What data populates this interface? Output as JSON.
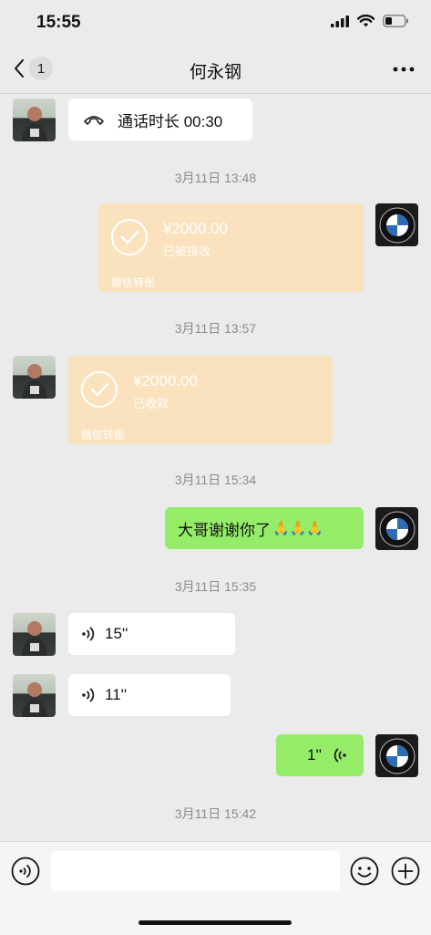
{
  "status_bar": {
    "time": "15:55"
  },
  "nav": {
    "back_count": "1",
    "title": "何永钢"
  },
  "messages": {
    "call": {
      "text": "通话时长 00:30"
    },
    "time1": "3月11日 13:48",
    "transfer1": {
      "amount": "¥2000.00",
      "status": "已被接收",
      "footer": "微信转账"
    },
    "time2": "3月11日 13:57",
    "transfer2": {
      "amount": "¥2000.00",
      "status": "已收款",
      "footer": "微信转账"
    },
    "time3": "3月11日 15:34",
    "thanks": {
      "text": "大哥谢谢你了",
      "emoji": "🙏🙏🙏"
    },
    "time4": "3月11日 15:35",
    "voice1": {
      "duration": "15''"
    },
    "voice2": {
      "duration": "11''"
    },
    "voice3": {
      "duration": "1''"
    },
    "time5": "3月11日 15:42"
  },
  "brand": {
    "bmw_letters": [
      "B",
      "M",
      "W"
    ]
  },
  "colors": {
    "green_bubble": "#95ec69",
    "transfer": "#f9e2bd",
    "background": "#ebebeb"
  }
}
